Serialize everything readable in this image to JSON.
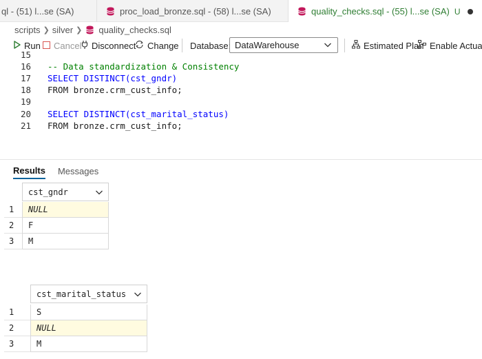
{
  "tabs": [
    {
      "label": "ql - (51) l...se (SA)",
      "active": false
    },
    {
      "label": "proc_load_bronze.sql - (58) l...se (SA)",
      "active": false
    },
    {
      "label": "quality_checks.sql - (55) l...se (SA)",
      "active": true,
      "status_letter": "U"
    }
  ],
  "breadcrumb": {
    "items": [
      "scripts",
      "silver"
    ],
    "file": "quality_checks.sql"
  },
  "toolbar": {
    "run": "Run",
    "cancel": "Cancel",
    "disconnect": "Disconnect",
    "change": "Change",
    "database_label": "Database:",
    "database_value": "DataWarehouse",
    "estimated_plan": "Estimated Plan",
    "enable_actual": "Enable Actual P"
  },
  "editor": {
    "partial_line_number": "15",
    "lines": [
      {
        "number": "16",
        "text": "-- Data standardization & Consistency"
      },
      {
        "number": "17",
        "text": "SELECT DISTINCT(cst_gndr)"
      },
      {
        "number": "18",
        "text": "FROM bronze.crm_cust_info;"
      },
      {
        "number": "19",
        "text": ""
      },
      {
        "number": "20",
        "text": "SELECT DISTINCT(cst_marital_status)"
      },
      {
        "number": "21",
        "text": "FROM bronze.crm_cust_info;"
      }
    ]
  },
  "results": {
    "tabs": [
      "Results",
      "Messages"
    ],
    "active_tab": "Results",
    "grids": [
      {
        "column": "cst_gndr",
        "rows": [
          {
            "n": "1",
            "value": "NULL"
          },
          {
            "n": "2",
            "value": "F"
          },
          {
            "n": "3",
            "value": "M"
          }
        ]
      },
      {
        "column": "cst_marital_status",
        "rows": [
          {
            "n": "1",
            "value": "S"
          },
          {
            "n": "2",
            "value": "NULL"
          },
          {
            "n": "3",
            "value": "M"
          }
        ]
      }
    ]
  },
  "colors": {
    "keyword": "#0000ff",
    "comment": "#008000",
    "active_tab_text": "#2e7d32",
    "db_icon": "#c2185b",
    "highlight_row": "#fffbe0"
  }
}
